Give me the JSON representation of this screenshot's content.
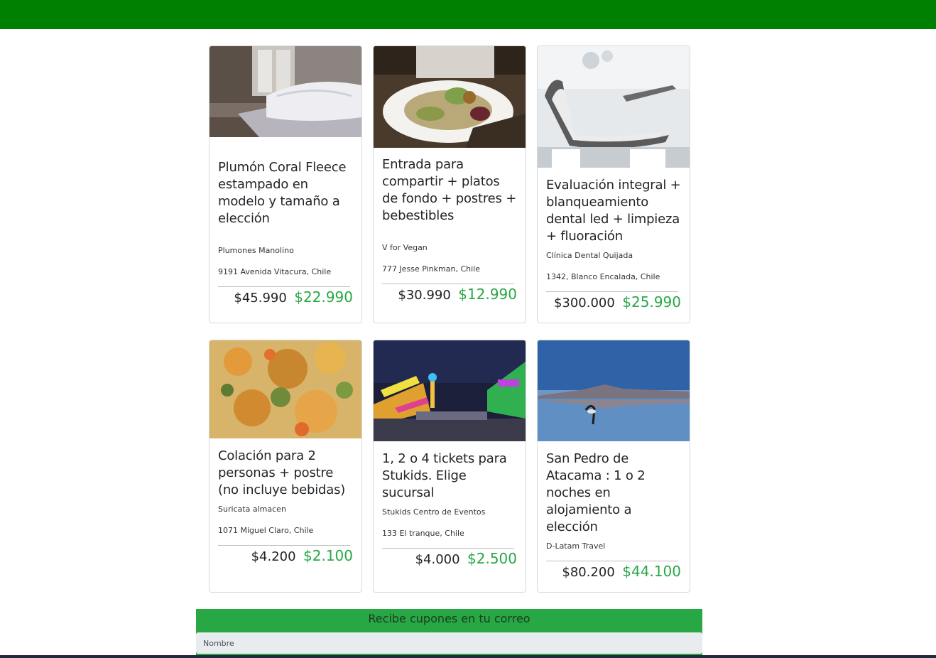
{
  "theme": {
    "header_color": "#008000",
    "accent_green": "#28a745"
  },
  "deals": [
    {
      "title": "Plumón Coral Fleece estampado en modelo y tamaño a elección",
      "vendor": "Plumones Manolino",
      "address": "9191 Avenida Vitacura, Chile",
      "old_price": "$45.990",
      "new_price": "$22.990",
      "image": "bedroom-photo"
    },
    {
      "title": "Entrada para compartir + platos de fondo + postres + bebestibles",
      "vendor": "V for Vegan",
      "address": "777 Jesse Pinkman, Chile",
      "old_price": "$30.990",
      "new_price": "$12.990",
      "image": "vegan-salad-photo"
    },
    {
      "title": "Evaluación integral + blanqueamiento dental led + limpieza + fluoración",
      "vendor": "Clínica Dental Quijada",
      "address": "1342, Blanco Encalada, Chile",
      "old_price": "$300.000",
      "new_price": "$25.990",
      "image": "dental-chair-photo"
    },
    {
      "title": "Colación para 2 personas + postre (no incluye bebidas)",
      "vendor": "Suricata almacen",
      "address": "1071 Miguel Claro, Chile",
      "old_price": "$4.200",
      "new_price": "$2.100",
      "image": "stew-photo"
    },
    {
      "title": "1, 2 o 4 tickets para Stukids. Elige sucursal",
      "vendor": "Stukids Centro de Eventos",
      "address": "133 El tranque, Chile",
      "old_price": "$4.000",
      "new_price": "$2.500",
      "image": "fairground-photo"
    },
    {
      "title": "San Pedro de Atacama : 1 o 2 noches en alojamiento a elección",
      "vendor": "D-Latam Travel",
      "address": "",
      "old_price": "$80.200",
      "new_price": "$44.100",
      "image": "flamingo-lagoon-photo"
    }
  ],
  "newsletter": {
    "title": "Recibe cupones en tu correo",
    "name_placeholder": "Nombre"
  }
}
